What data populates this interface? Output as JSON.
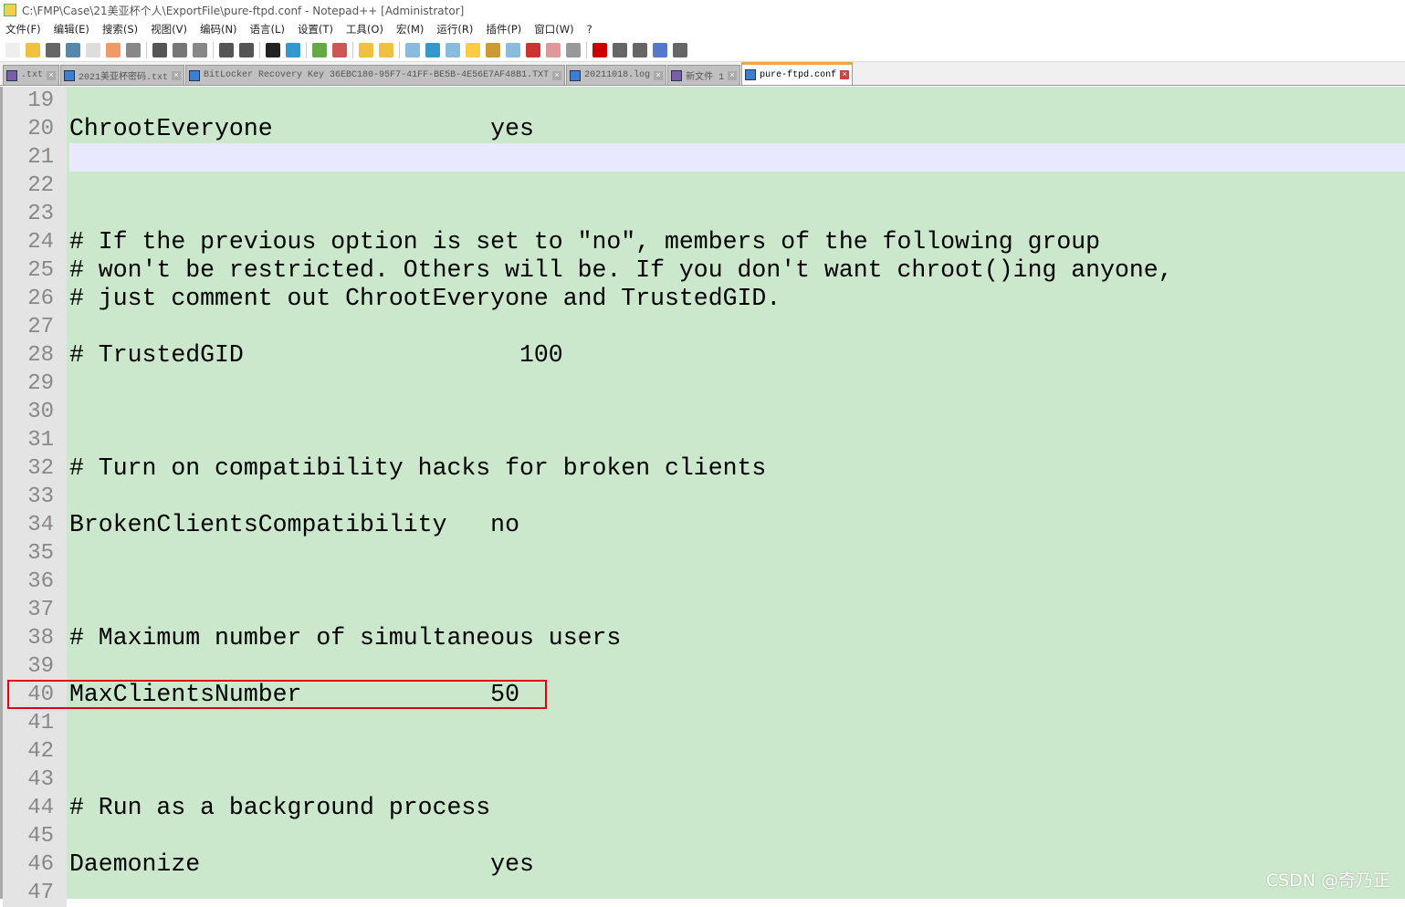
{
  "title": "C:\\FMP\\Case\\21美亚杯个人\\ExportFile\\pure-ftpd.conf - Notepad++ [Administrator]",
  "menu": [
    "文件(F)",
    "编辑(E)",
    "搜索(S)",
    "视图(V)",
    "编码(N)",
    "语言(L)",
    "设置(T)",
    "工具(O)",
    "宏(M)",
    "运行(R)",
    "插件(P)",
    "窗口(W)",
    "?"
  ],
  "tabs": [
    {
      "label": ".txt",
      "icon": "save-icon-purple"
    },
    {
      "label": "2021美亚杯密码.txt",
      "icon": "save-icon"
    },
    {
      "label": "BitLocker Recovery Key 36EBC180-95F7-41FF-BE5B-4E56E7AF48B1.TXT",
      "icon": "save-icon"
    },
    {
      "label": "20211018.log",
      "icon": "save-icon"
    },
    {
      "label": "新文件 1",
      "icon": "save-icon-purple"
    },
    {
      "label": "pure-ftpd.conf",
      "icon": "save-icon",
      "active": true
    }
  ],
  "editor": {
    "current_line": 21,
    "highlighted_line": 40,
    "lines": [
      {
        "n": "19",
        "t": ""
      },
      {
        "n": "20",
        "t": "ChrootEveryone               yes"
      },
      {
        "n": "21",
        "t": ""
      },
      {
        "n": "22",
        "t": ""
      },
      {
        "n": "23",
        "t": ""
      },
      {
        "n": "24",
        "t": "# If the previous option is set to \"no\", members of the following group"
      },
      {
        "n": "25",
        "t": "# won't be restricted. Others will be. If you don't want chroot()ing anyone,"
      },
      {
        "n": "26",
        "t": "# just comment out ChrootEveryone and TrustedGID."
      },
      {
        "n": "27",
        "t": ""
      },
      {
        "n": "28",
        "t": "# TrustedGID                   100"
      },
      {
        "n": "29",
        "t": ""
      },
      {
        "n": "30",
        "t": ""
      },
      {
        "n": "31",
        "t": ""
      },
      {
        "n": "32",
        "t": "# Turn on compatibility hacks for broken clients"
      },
      {
        "n": "33",
        "t": ""
      },
      {
        "n": "34",
        "t": "BrokenClientsCompatibility   no"
      },
      {
        "n": "35",
        "t": ""
      },
      {
        "n": "36",
        "t": ""
      },
      {
        "n": "37",
        "t": ""
      },
      {
        "n": "38",
        "t": "# Maximum number of simultaneous users"
      },
      {
        "n": "39",
        "t": ""
      },
      {
        "n": "40",
        "t": "MaxClientsNumber             50"
      },
      {
        "n": "41",
        "t": ""
      },
      {
        "n": "42",
        "t": ""
      },
      {
        "n": "43",
        "t": ""
      },
      {
        "n": "44",
        "t": "# Run as a background process"
      },
      {
        "n": "45",
        "t": ""
      },
      {
        "n": "46",
        "t": "Daemonize                    yes"
      },
      {
        "n": "47",
        "t": ""
      }
    ]
  },
  "watermark": "CSDN @奇乃正"
}
